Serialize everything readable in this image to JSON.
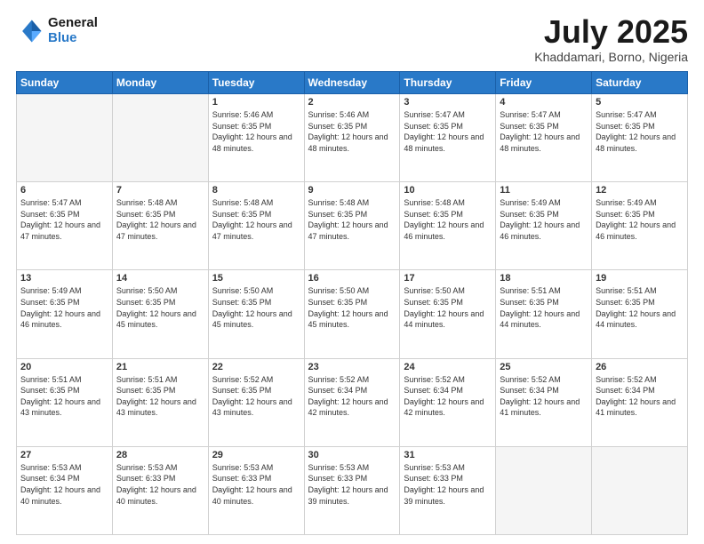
{
  "header": {
    "logo_line1": "General",
    "logo_line2": "Blue",
    "title": "July 2025",
    "location": "Khaddamari, Borno, Nigeria"
  },
  "weekdays": [
    "Sunday",
    "Monday",
    "Tuesday",
    "Wednesday",
    "Thursday",
    "Friday",
    "Saturday"
  ],
  "weeks": [
    [
      {
        "day": "",
        "sunrise": "",
        "sunset": "",
        "daylight": ""
      },
      {
        "day": "",
        "sunrise": "",
        "sunset": "",
        "daylight": ""
      },
      {
        "day": "1",
        "sunrise": "Sunrise: 5:46 AM",
        "sunset": "Sunset: 6:35 PM",
        "daylight": "Daylight: 12 hours and 48 minutes."
      },
      {
        "day": "2",
        "sunrise": "Sunrise: 5:46 AM",
        "sunset": "Sunset: 6:35 PM",
        "daylight": "Daylight: 12 hours and 48 minutes."
      },
      {
        "day": "3",
        "sunrise": "Sunrise: 5:47 AM",
        "sunset": "Sunset: 6:35 PM",
        "daylight": "Daylight: 12 hours and 48 minutes."
      },
      {
        "day": "4",
        "sunrise": "Sunrise: 5:47 AM",
        "sunset": "Sunset: 6:35 PM",
        "daylight": "Daylight: 12 hours and 48 minutes."
      },
      {
        "day": "5",
        "sunrise": "Sunrise: 5:47 AM",
        "sunset": "Sunset: 6:35 PM",
        "daylight": "Daylight: 12 hours and 48 minutes."
      }
    ],
    [
      {
        "day": "6",
        "sunrise": "Sunrise: 5:47 AM",
        "sunset": "Sunset: 6:35 PM",
        "daylight": "Daylight: 12 hours and 47 minutes."
      },
      {
        "day": "7",
        "sunrise": "Sunrise: 5:48 AM",
        "sunset": "Sunset: 6:35 PM",
        "daylight": "Daylight: 12 hours and 47 minutes."
      },
      {
        "day": "8",
        "sunrise": "Sunrise: 5:48 AM",
        "sunset": "Sunset: 6:35 PM",
        "daylight": "Daylight: 12 hours and 47 minutes."
      },
      {
        "day": "9",
        "sunrise": "Sunrise: 5:48 AM",
        "sunset": "Sunset: 6:35 PM",
        "daylight": "Daylight: 12 hours and 47 minutes."
      },
      {
        "day": "10",
        "sunrise": "Sunrise: 5:48 AM",
        "sunset": "Sunset: 6:35 PM",
        "daylight": "Daylight: 12 hours and 46 minutes."
      },
      {
        "day": "11",
        "sunrise": "Sunrise: 5:49 AM",
        "sunset": "Sunset: 6:35 PM",
        "daylight": "Daylight: 12 hours and 46 minutes."
      },
      {
        "day": "12",
        "sunrise": "Sunrise: 5:49 AM",
        "sunset": "Sunset: 6:35 PM",
        "daylight": "Daylight: 12 hours and 46 minutes."
      }
    ],
    [
      {
        "day": "13",
        "sunrise": "Sunrise: 5:49 AM",
        "sunset": "Sunset: 6:35 PM",
        "daylight": "Daylight: 12 hours and 46 minutes."
      },
      {
        "day": "14",
        "sunrise": "Sunrise: 5:50 AM",
        "sunset": "Sunset: 6:35 PM",
        "daylight": "Daylight: 12 hours and 45 minutes."
      },
      {
        "day": "15",
        "sunrise": "Sunrise: 5:50 AM",
        "sunset": "Sunset: 6:35 PM",
        "daylight": "Daylight: 12 hours and 45 minutes."
      },
      {
        "day": "16",
        "sunrise": "Sunrise: 5:50 AM",
        "sunset": "Sunset: 6:35 PM",
        "daylight": "Daylight: 12 hours and 45 minutes."
      },
      {
        "day": "17",
        "sunrise": "Sunrise: 5:50 AM",
        "sunset": "Sunset: 6:35 PM",
        "daylight": "Daylight: 12 hours and 44 minutes."
      },
      {
        "day": "18",
        "sunrise": "Sunrise: 5:51 AM",
        "sunset": "Sunset: 6:35 PM",
        "daylight": "Daylight: 12 hours and 44 minutes."
      },
      {
        "day": "19",
        "sunrise": "Sunrise: 5:51 AM",
        "sunset": "Sunset: 6:35 PM",
        "daylight": "Daylight: 12 hours and 44 minutes."
      }
    ],
    [
      {
        "day": "20",
        "sunrise": "Sunrise: 5:51 AM",
        "sunset": "Sunset: 6:35 PM",
        "daylight": "Daylight: 12 hours and 43 minutes."
      },
      {
        "day": "21",
        "sunrise": "Sunrise: 5:51 AM",
        "sunset": "Sunset: 6:35 PM",
        "daylight": "Daylight: 12 hours and 43 minutes."
      },
      {
        "day": "22",
        "sunrise": "Sunrise: 5:52 AM",
        "sunset": "Sunset: 6:35 PM",
        "daylight": "Daylight: 12 hours and 43 minutes."
      },
      {
        "day": "23",
        "sunrise": "Sunrise: 5:52 AM",
        "sunset": "Sunset: 6:34 PM",
        "daylight": "Daylight: 12 hours and 42 minutes."
      },
      {
        "day": "24",
        "sunrise": "Sunrise: 5:52 AM",
        "sunset": "Sunset: 6:34 PM",
        "daylight": "Daylight: 12 hours and 42 minutes."
      },
      {
        "day": "25",
        "sunrise": "Sunrise: 5:52 AM",
        "sunset": "Sunset: 6:34 PM",
        "daylight": "Daylight: 12 hours and 41 minutes."
      },
      {
        "day": "26",
        "sunrise": "Sunrise: 5:52 AM",
        "sunset": "Sunset: 6:34 PM",
        "daylight": "Daylight: 12 hours and 41 minutes."
      }
    ],
    [
      {
        "day": "27",
        "sunrise": "Sunrise: 5:53 AM",
        "sunset": "Sunset: 6:34 PM",
        "daylight": "Daylight: 12 hours and 40 minutes."
      },
      {
        "day": "28",
        "sunrise": "Sunrise: 5:53 AM",
        "sunset": "Sunset: 6:33 PM",
        "daylight": "Daylight: 12 hours and 40 minutes."
      },
      {
        "day": "29",
        "sunrise": "Sunrise: 5:53 AM",
        "sunset": "Sunset: 6:33 PM",
        "daylight": "Daylight: 12 hours and 40 minutes."
      },
      {
        "day": "30",
        "sunrise": "Sunrise: 5:53 AM",
        "sunset": "Sunset: 6:33 PM",
        "daylight": "Daylight: 12 hours and 39 minutes."
      },
      {
        "day": "31",
        "sunrise": "Sunrise: 5:53 AM",
        "sunset": "Sunset: 6:33 PM",
        "daylight": "Daylight: 12 hours and 39 minutes."
      },
      {
        "day": "",
        "sunrise": "",
        "sunset": "",
        "daylight": ""
      },
      {
        "day": "",
        "sunrise": "",
        "sunset": "",
        "daylight": ""
      }
    ]
  ]
}
